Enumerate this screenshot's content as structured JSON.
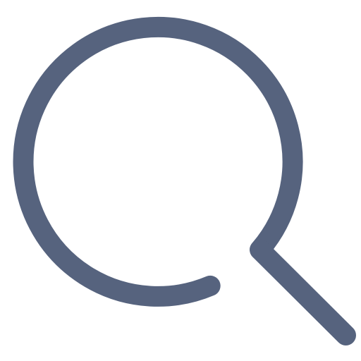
{
  "icon": {
    "name": "search-icon",
    "color": "#56637E",
    "background": "#FFFFFF"
  }
}
